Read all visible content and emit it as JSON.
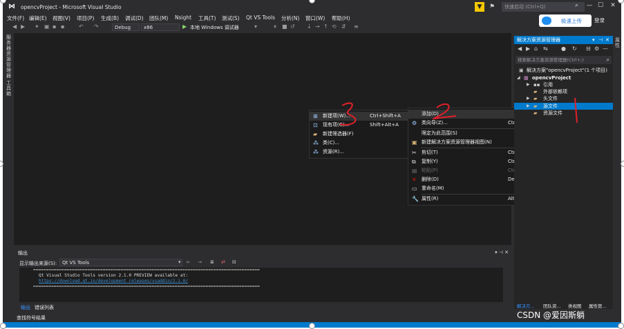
{
  "window": {
    "title": "opencvProject - Microsoft Visual Studio",
    "quick_launch_placeholder": "快速启动 (Ctrl+Q)",
    "controls": {
      "minimize": "—",
      "maximize": "☐",
      "close": "✕"
    }
  },
  "menu": [
    "文件(F)",
    "编辑(E)",
    "视图(V)",
    "项目(P)",
    "生成(B)",
    "调试(D)",
    "团队(M)",
    "Nsight",
    "工具(T)",
    "测试(S)",
    "Qt VS Tools",
    "分析(N)",
    "窗口(W)",
    "帮助(H)"
  ],
  "upload_badge": {
    "label": "极速上传"
  },
  "login_text": "登录",
  "toolbar": {
    "config": "Debug",
    "platform": "x86",
    "debugger": "本地 Windows 调试器"
  },
  "left_vertical_tabs": [
    "服务器资源管理器",
    "工具箱"
  ],
  "context_menu_add": {
    "items": [
      {
        "icon": "new-item-icon",
        "label": "新建项(W)...",
        "shortcut": "Ctrl+Shift+A"
      },
      {
        "icon": "existing-item-icon",
        "label": "现有项(G)...",
        "shortcut": "Shift+Alt+A"
      },
      {
        "icon": "new-filter-icon",
        "label": "新建筛选器(F)",
        "shortcut": ""
      },
      {
        "icon": "class-icon",
        "label": "类(C)...",
        "shortcut": ""
      },
      {
        "icon": "resource-icon",
        "label": "资源(R)...",
        "shortcut": ""
      }
    ]
  },
  "context_menu_main": {
    "items": [
      {
        "icon": "",
        "label": "添加(D)",
        "shortcut": "",
        "submenu": true
      },
      {
        "icon": "class-wizard-icon",
        "label": "类向导(Z)...",
        "shortcut": "Ctrl+Shift+X"
      },
      {
        "icon": "",
        "label": "限定为此范围(S)",
        "shortcut": ""
      },
      {
        "icon": "new-solution-view-icon",
        "label": "新建解决方案资源管理器视图(N)",
        "shortcut": ""
      },
      {
        "icon": "cut-icon",
        "label": "剪切(T)",
        "shortcut": "Ctrl+X"
      },
      {
        "icon": "copy-icon",
        "label": "复制(Y)",
        "shortcut": "Ctrl+C"
      },
      {
        "icon": "paste-icon",
        "label": "粘贴(P)",
        "shortcut": "Ctrl+V",
        "disabled": true
      },
      {
        "icon": "delete-icon",
        "label": "删除(D)",
        "shortcut": "Del"
      },
      {
        "icon": "rename-icon",
        "label": "重命名(M)",
        "shortcut": ""
      },
      {
        "icon": "properties-icon",
        "label": "属性(R)",
        "shortcut": "Alt+Enter"
      }
    ]
  },
  "output": {
    "title": "输出",
    "source_label": "显示输出来源(S):",
    "source_value": "Qt VS Tools",
    "lines": [
      "========================================================================================",
      "Qt Visual Studio Tools version 2.1.0 PREVIEW available at:",
      "https://download.qt.io/development_releases/vsaddin/2.1.0/",
      "========================================================================================"
    ],
    "tabs": [
      "输出",
      "错误列表"
    ],
    "find_results": "查找符号结果"
  },
  "solution_explorer": {
    "title": "解决方案资源管理器",
    "search_placeholder": "搜索解决方案资源管理器(Ctrl+;)",
    "tree": [
      {
        "label": "解决方案\"opencvProject\"(1 个项目)",
        "level": 0,
        "icon": "solution-icon"
      },
      {
        "label": "opencvProject",
        "level": 1,
        "icon": "project-icon",
        "bold": true
      },
      {
        "label": "引用",
        "level": 2,
        "icon": "references-icon"
      },
      {
        "label": "外部依赖项",
        "level": 2,
        "icon": "external-deps-icon"
      },
      {
        "label": "头文件",
        "level": 2,
        "icon": "folder-icon"
      },
      {
        "label": "源文件",
        "level": 2,
        "icon": "folder-icon",
        "selected": true
      },
      {
        "label": "资源文件",
        "level": 2,
        "icon": "folder-icon"
      }
    ],
    "tabs": [
      "解决方...",
      "团队资...",
      "类视图",
      "属性管..."
    ]
  },
  "watermark": "CSDN @爱因斯躺",
  "colors": {
    "accent": "#007acc",
    "annotation": "#e0202a",
    "background": "#1e1e1e",
    "chrome": "#2d2d30"
  }
}
